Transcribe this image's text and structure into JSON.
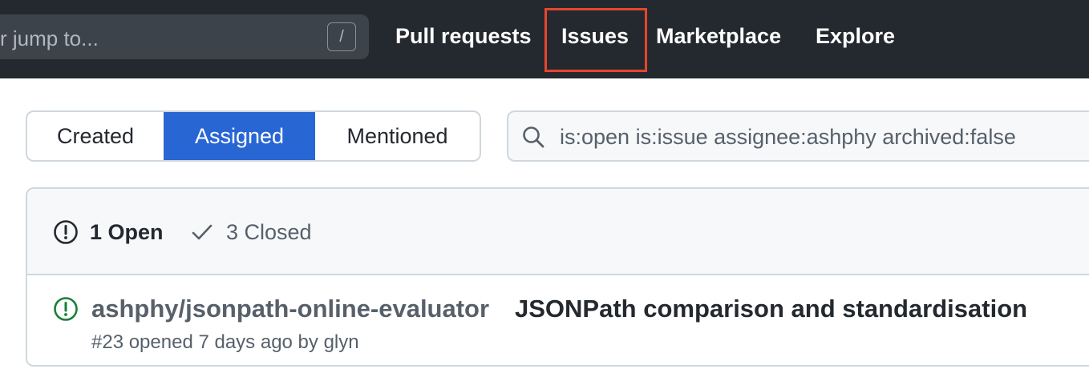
{
  "header": {
    "search_placeholder": "r jump to...",
    "slash_key": "/",
    "nav": [
      "Pull requests",
      "Issues",
      "Marketplace",
      "Explore"
    ],
    "highlighted_nav": "Issues",
    "highlight_color": "#e8452c"
  },
  "subnav": {
    "tabs": [
      "Created",
      "Assigned",
      "Mentioned"
    ],
    "selected": "Assigned",
    "selected_color": "#2866d4"
  },
  "filter": {
    "value": "is:open is:issue assignee:ashphy archived:false",
    "icon": "search-icon"
  },
  "issues_box": {
    "open_label": "1 Open",
    "closed_label": "3 Closed",
    "issues": [
      {
        "repo": "ashphy/jsonpath-online-evaluator",
        "title": "JSONPath comparison and standardisation",
        "meta_prefix": "#23 opened 7 days ago by ",
        "author": "glyn",
        "status": "open",
        "status_color": "#1a7f37"
      }
    ]
  }
}
